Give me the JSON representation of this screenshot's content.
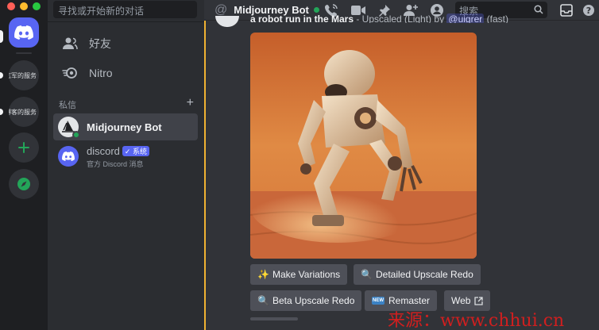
{
  "servers": [
    {
      "label": "志军的服务"
    },
    {
      "label": "博客的服务"
    }
  ],
  "dm_sidebar": {
    "search_placeholder": "寻找或开始新的对话",
    "nav": [
      {
        "label": "好友",
        "icon": "friends-icon"
      },
      {
        "label": "Nitro",
        "icon": "nitro-icon"
      }
    ],
    "section_title": "私信",
    "dms": [
      {
        "name": "Midjourney Bot",
        "status": "online"
      },
      {
        "name": "discord",
        "badge": "✓ 系统",
        "subtitle": "官方 Discord 消息"
      }
    ]
  },
  "header": {
    "channel_name": "Midjourney Bot",
    "search_placeholder": "搜索"
  },
  "message": {
    "prompt_text": "a robot run in the Mars",
    "suffix_text": " - Upscaled (Light) by ",
    "mention": "@uigrer",
    "speed": " (fast)"
  },
  "buttons": {
    "make_variations": "Make Variations",
    "detailed_upscale_redo": "Detailed Upscale Redo",
    "beta_upscale_redo": "Beta Upscale Redo",
    "remaster": "Remaster",
    "remaster_tag": "NEW",
    "web": "Web"
  },
  "watermark": "来源：www.chhui.cn",
  "colors": {
    "blurple": "#5865f2",
    "online": "#23a559",
    "accent": "#f0b232"
  }
}
